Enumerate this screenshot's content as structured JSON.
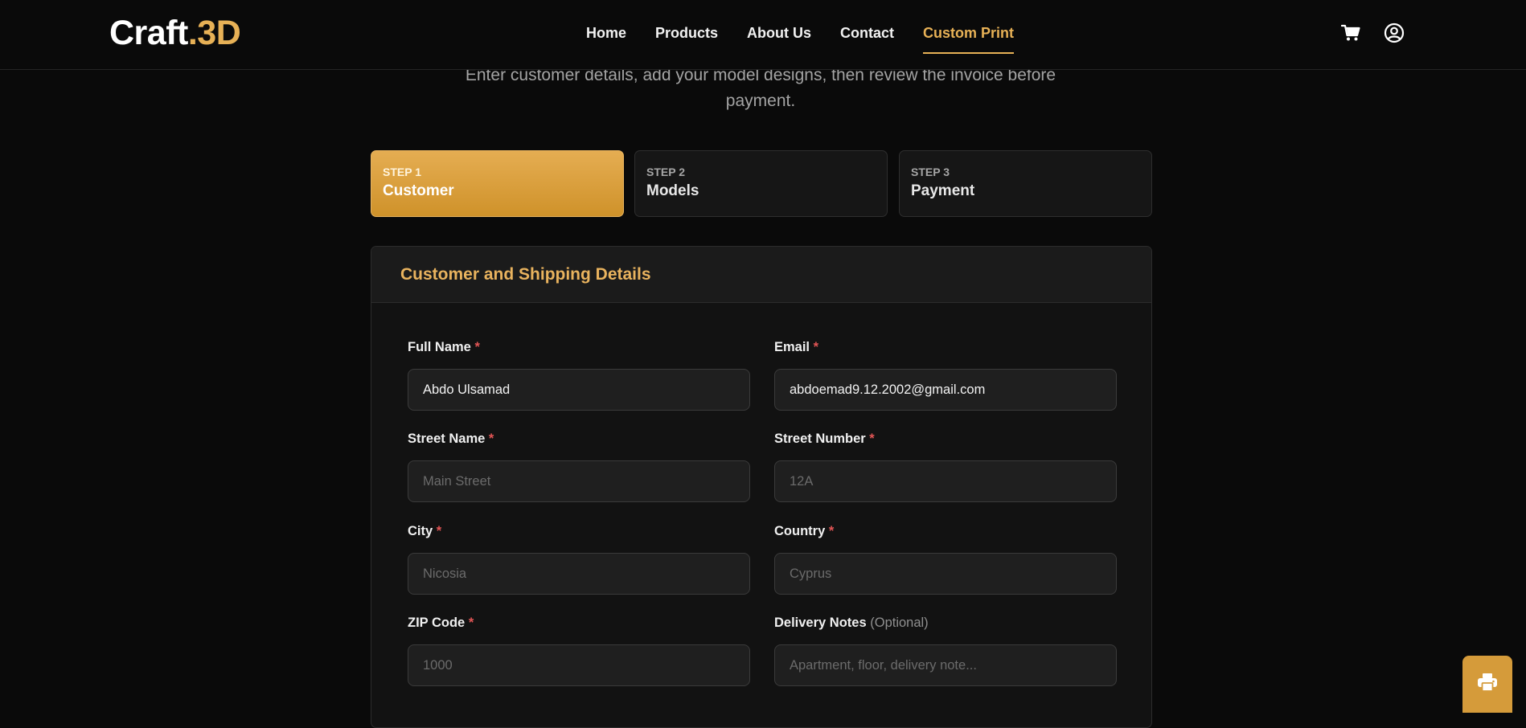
{
  "brand": {
    "name_main": "Craft",
    "name_accent": ".3D"
  },
  "nav": {
    "links": [
      "Home",
      "Products",
      "About Us",
      "Contact",
      "Custom Print"
    ],
    "active": "Custom Print"
  },
  "icons": {
    "cart": "cart-icon",
    "user": "user-circle-icon",
    "print": "printer-icon"
  },
  "intro": {
    "text": "Enter customer details, add your model designs, then review the invoice before payment."
  },
  "steps": [
    {
      "label": "STEP 1",
      "title": "Customer",
      "active": true
    },
    {
      "label": "STEP 2",
      "title": "Models",
      "active": false
    },
    {
      "label": "STEP 3",
      "title": "Payment",
      "active": false
    }
  ],
  "form": {
    "title": "Customer and Shipping Details",
    "required_marker": "*",
    "optional_marker": "(Optional)",
    "fields": {
      "full_name": {
        "label": "Full Name",
        "value": "Abdo Ulsamad",
        "placeholder": ""
      },
      "email": {
        "label": "Email",
        "value": "abdoemad9.12.2002@gmail.com",
        "placeholder": ""
      },
      "street_name": {
        "label": "Street Name",
        "value": "",
        "placeholder": "Main Street"
      },
      "street_number": {
        "label": "Street Number",
        "value": "",
        "placeholder": "12A"
      },
      "city": {
        "label": "City",
        "value": "",
        "placeholder": "Nicosia"
      },
      "country": {
        "label": "Country",
        "value": "",
        "placeholder": "Cyprus"
      },
      "zip_code": {
        "label": "ZIP Code",
        "value": "",
        "placeholder": "1000"
      },
      "delivery_notes": {
        "label": "Delivery Notes",
        "value": "",
        "placeholder": "Apartment, floor, delivery note..."
      }
    }
  },
  "colors": {
    "accent": "#e7b156",
    "background": "#0a0a0a",
    "required": "#e25555"
  }
}
